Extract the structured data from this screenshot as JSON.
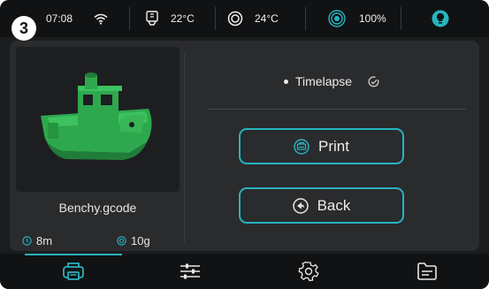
{
  "step_badge": "3",
  "status": {
    "time": "07:08",
    "wifi_icon": "wifi-icon",
    "nozzle_temp": "22°C",
    "bed_temp": "24°C",
    "fan_speed": "100%",
    "light_icon": "bulb-icon"
  },
  "file": {
    "name": "Benchy.gcode",
    "time": "8m",
    "weight": "10g"
  },
  "options": {
    "timelapse_label": "Timelapse"
  },
  "buttons": {
    "print_label": "Print",
    "back_label": "Back"
  },
  "nav": [
    {
      "icon": "printer-icon",
      "active": true
    },
    {
      "icon": "sliders-icon",
      "active": false
    },
    {
      "icon": "gear-icon",
      "active": false
    },
    {
      "icon": "folder-icon",
      "active": false
    }
  ],
  "colors": {
    "accent": "#27b3c0",
    "model": "#2ea84e",
    "background": "#1b1c1e"
  }
}
